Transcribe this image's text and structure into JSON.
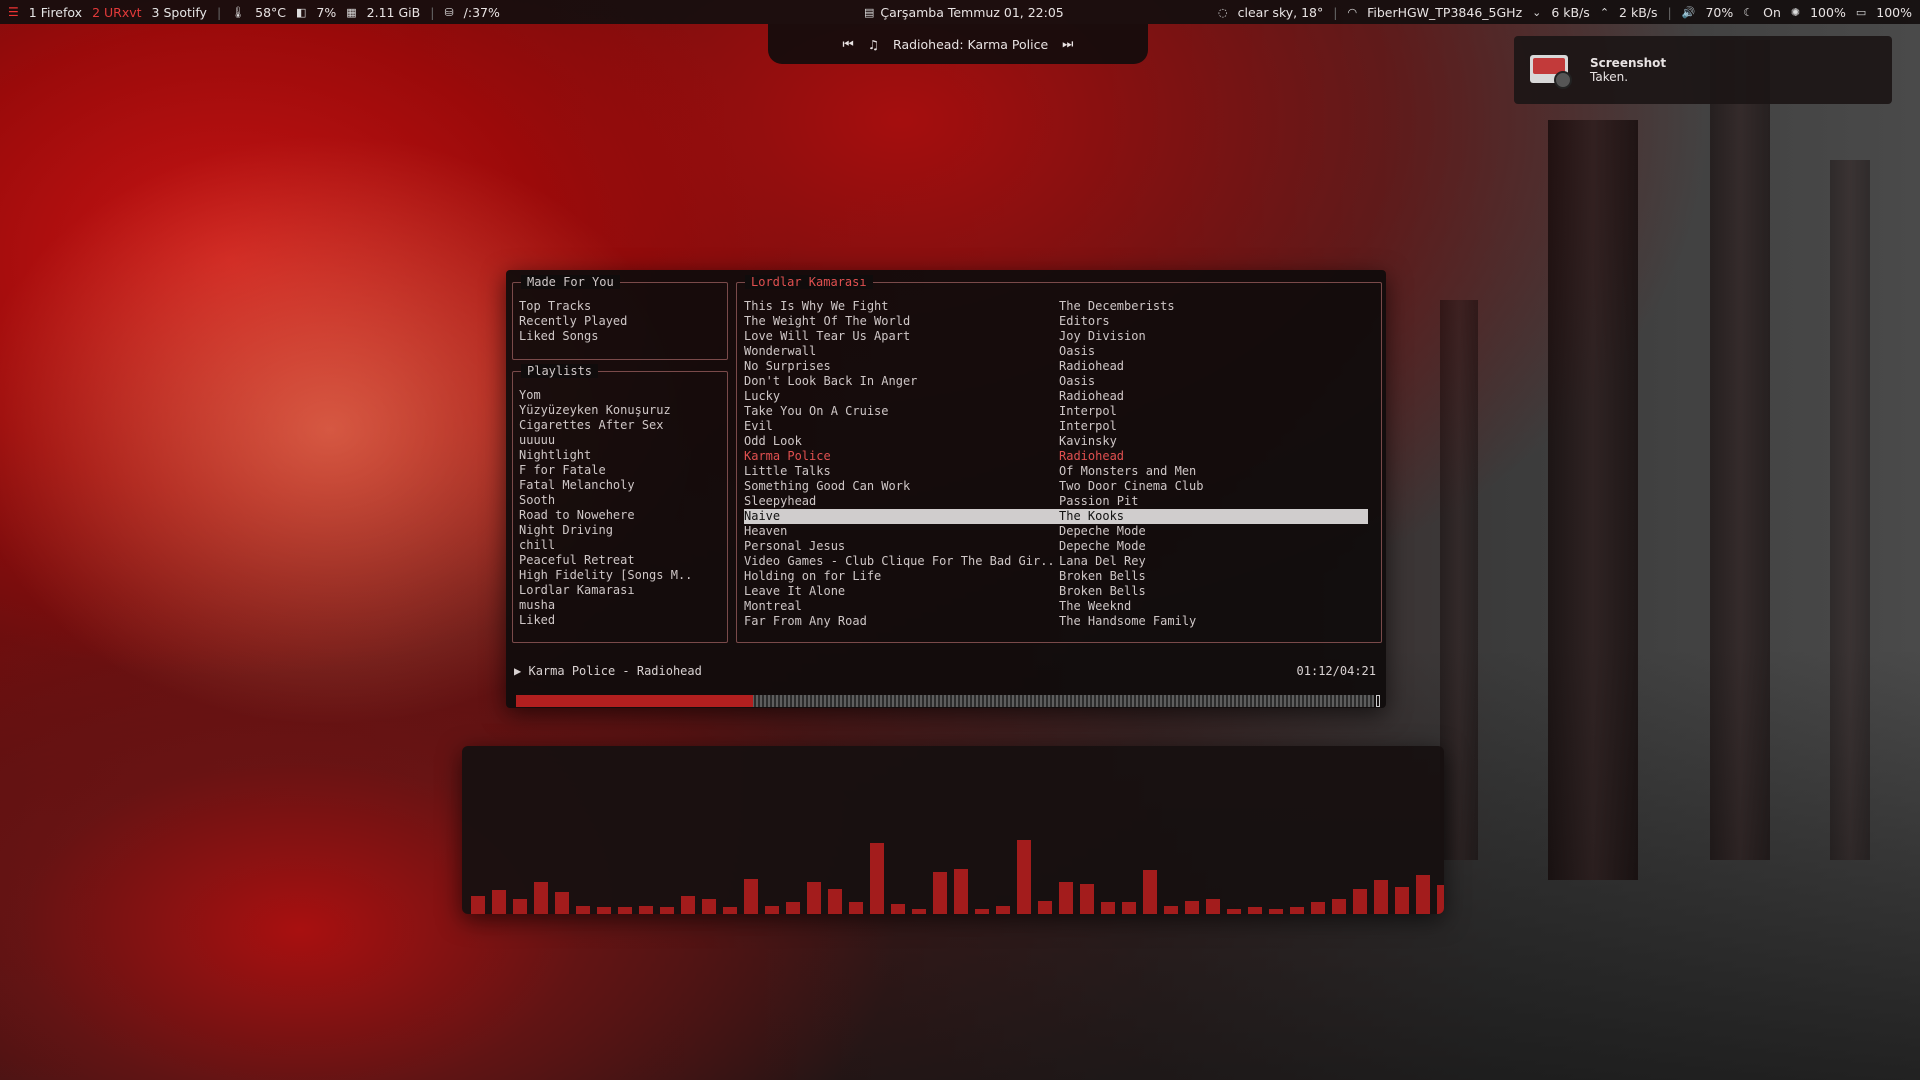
{
  "topbar": {
    "workspaces": [
      {
        "label": "1 Firefox",
        "active": false
      },
      {
        "label": "2 URxvt",
        "active": true
      },
      {
        "label": "3 Spotify",
        "active": false
      }
    ],
    "cpu_temp": "58°C",
    "cpu_usage": "7%",
    "memory": "2.11 GiB",
    "disk": "/:37%",
    "datetime": "Çarşamba Temmuz 01,  22:05",
    "weather": "clear sky, 18°",
    "wifi": "FiberHGW_TP3846_5GHz",
    "net_down": "6 kB/s",
    "net_up": "2 kB/s",
    "volume": "70%",
    "night_mode": "On",
    "brightness": "100%",
    "battery": "100%"
  },
  "now_playing_pill": {
    "text": "Radiohead: Karma Police"
  },
  "notification": {
    "title": "Screenshot",
    "body": "Taken."
  },
  "spotify_tui": {
    "made_for_you": {
      "title": "Made For You",
      "items": [
        "Top Tracks",
        "Recently Played",
        "Liked Songs"
      ]
    },
    "playlists": {
      "title": "Playlists",
      "items": [
        "Yom",
        "Yüzyüzeyken Konuşuruz",
        "Cigarettes After Sex",
        "uuuuu",
        "Nightlight",
        "F for Fatale",
        "Fatal Melancholy",
        "Sooth",
        "Road to Nowehere",
        "Night Driving",
        "chill",
        "Peaceful Retreat",
        "High Fidelity [Songs M..",
        "Lordlar Kamarası",
        "musha",
        "Liked"
      ]
    },
    "tracklist": {
      "title": "Lordlar Kamarası",
      "tracks": [
        {
          "title": "This Is Why We Fight",
          "artist": "The Decemberists"
        },
        {
          "title": "The Weight Of The World",
          "artist": "Editors"
        },
        {
          "title": "Love Will Tear Us Apart",
          "artist": "Joy Division"
        },
        {
          "title": "Wonderwall",
          "artist": "Oasis"
        },
        {
          "title": "No Surprises",
          "artist": "Radiohead"
        },
        {
          "title": "Don't Look Back In Anger",
          "artist": "Oasis"
        },
        {
          "title": "Lucky",
          "artist": "Radiohead"
        },
        {
          "title": "Take You On A Cruise",
          "artist": "Interpol"
        },
        {
          "title": "Evil",
          "artist": "Interpol"
        },
        {
          "title": "Odd Look",
          "artist": "Kavinsky"
        },
        {
          "title": "Karma Police",
          "artist": "Radiohead",
          "playing": true
        },
        {
          "title": "Little Talks",
          "artist": "Of Monsters and Men"
        },
        {
          "title": "Something Good Can Work",
          "artist": "Two Door Cinema Club"
        },
        {
          "title": "Sleepyhead",
          "artist": "Passion Pit"
        },
        {
          "title": "Naive",
          "artist": "The Kooks",
          "selected": true
        },
        {
          "title": "Heaven",
          "artist": "Depeche Mode"
        },
        {
          "title": "Personal Jesus",
          "artist": "Depeche Mode"
        },
        {
          "title": "Video Games - Club Clique For The Bad Gir..",
          "artist": "Lana Del Rey"
        },
        {
          "title": "Holding on for Life",
          "artist": "Broken Bells"
        },
        {
          "title": "Leave It Alone",
          "artist": "Broken Bells"
        },
        {
          "title": "Montreal",
          "artist": "The Weeknd"
        },
        {
          "title": "Far From Any Road",
          "artist": "The Handsome Family"
        }
      ]
    },
    "playback": {
      "play_icon": "▶",
      "now_playing": "Karma Police - Radiohead",
      "time": "01:12/04:21",
      "progress_fraction": 0.276
    }
  },
  "visualizer": {
    "bar_color": "#a31c1c",
    "levels": [
      0.11,
      0.14,
      0.09,
      0.19,
      0.13,
      0.05,
      0.04,
      0.04,
      0.05,
      0.04,
      0.11,
      0.09,
      0.04,
      0.21,
      0.05,
      0.07,
      0.19,
      0.15,
      0.07,
      0.42,
      0.06,
      0.03,
      0.25,
      0.27,
      0.03,
      0.05,
      0.44,
      0.08,
      0.19,
      0.18,
      0.07,
      0.07,
      0.26,
      0.05,
      0.08,
      0.09,
      0.03,
      0.04,
      0.03,
      0.04,
      0.07,
      0.09,
      0.15,
      0.2,
      0.16,
      0.23,
      0.17
    ]
  },
  "colors": {
    "accent": "#e33a3a",
    "pane_border": "#7a4a4a",
    "selection_bg": "#d0cdcd"
  }
}
